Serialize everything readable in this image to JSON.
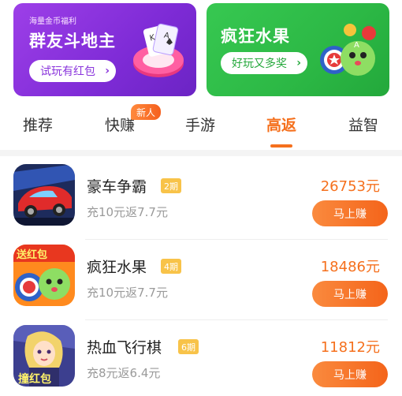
{
  "banners": [
    {
      "small": "海量金币福利",
      "title": "群友斗地主",
      "button": "试玩有红包",
      "art_icon": "poker-chip-cards-icon"
    },
    {
      "small": "",
      "title": "疯狂水果",
      "button": "好玩又多奖",
      "art_icon": "fruit-mascot-icon"
    }
  ],
  "tabs": [
    {
      "label": "推荐"
    },
    {
      "label": "快赚",
      "badge": "新人"
    },
    {
      "label": "手游"
    },
    {
      "label": "高返",
      "active": true
    },
    {
      "label": "益智"
    }
  ],
  "games": [
    {
      "name": "豪车争霸",
      "period": "2期",
      "rebate": "充10元返7.7元",
      "amount": "26753元",
      "button": "马上赚",
      "icon": "race-car-icon"
    },
    {
      "name": "疯狂水果",
      "period": "4期",
      "rebate": "充10元返7.7元",
      "amount": "18486元",
      "button": "马上赚",
      "icon": "fruit-mascot-icon",
      "icon_label": "送红包"
    },
    {
      "name": "热血飞行棋",
      "period": "6期",
      "rebate": "充8元返6.4元",
      "amount": "11812元",
      "button": "马上赚",
      "icon": "flying-chess-girl-icon",
      "icon_label": "撞红包"
    }
  ],
  "colors": {
    "accent": "#f5701d",
    "purple_banner": "#8a35dc",
    "green_banner": "#2cb845",
    "period_badge": "#f8c349"
  }
}
